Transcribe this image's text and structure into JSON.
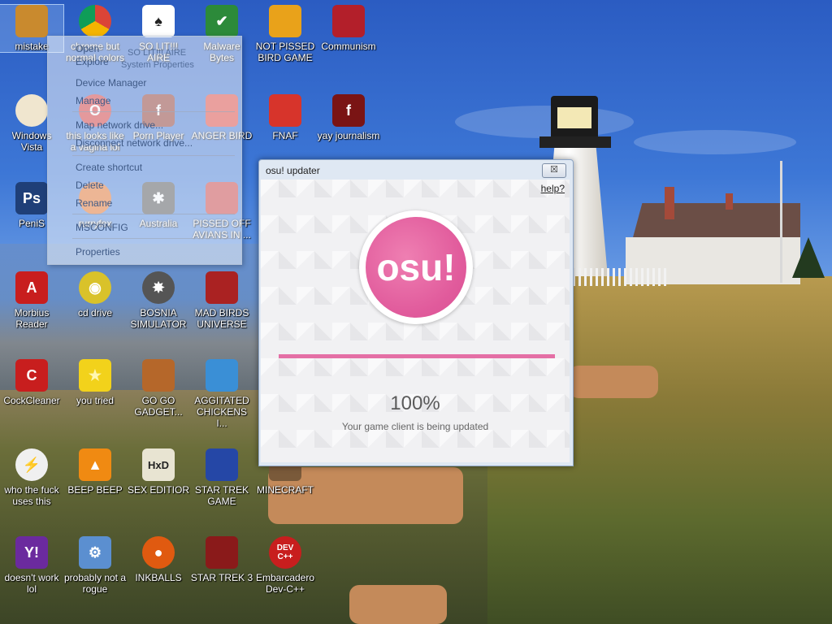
{
  "context_menu": {
    "items": [
      "Open",
      "Explore",
      "Manage",
      "Device Manager",
      "Map network drive...",
      "Disconnect network drive...",
      "Create shortcut",
      "Delete",
      "Rename",
      "MSCONFIG",
      "Properties"
    ],
    "overlay_labels": [
      "SO LIT!!! AIRE",
      "System Properties"
    ]
  },
  "icons": [
    {
      "label": "mistake",
      "icon": "folder-user-icon",
      "color": "#c98a2e",
      "glyph": ""
    },
    {
      "label": "chrome but normal colors",
      "icon": "chrome-icon",
      "color": "#3b8ee8",
      "glyph": ""
    },
    {
      "label": "SO LIT!!! AIRE",
      "icon": "solitaire-icon",
      "color": "#ffffff",
      "glyph": "♠"
    },
    {
      "label": "Malware Bytes",
      "icon": "shield-check-icon",
      "color": "#2c8a3a",
      "glyph": "✔"
    },
    {
      "label": "NOT PISSED BIRD GAME",
      "icon": "green-pig-icon",
      "color": "#e9a21a",
      "glyph": ""
    },
    {
      "label": "Communism",
      "icon": "winged-emblem-icon",
      "color": "#b31f2a",
      "glyph": ""
    },
    {
      "label": "Windows Vista",
      "icon": "egg-icon",
      "color": "#f0e6cf",
      "glyph": ""
    },
    {
      "label": "this looks like a vagina lol",
      "icon": "opera-icon",
      "color": "#d52b2b",
      "glyph": "O"
    },
    {
      "label": "Porn Player",
      "icon": "flash-player-icon",
      "color": "#8b2a20",
      "glyph": "f"
    },
    {
      "label": "ANGER BIRD",
      "icon": "red-bird-icon",
      "color": "#e23b2f",
      "glyph": ""
    },
    {
      "label": "FNAF",
      "icon": "red-bird-icon",
      "color": "#d7342b",
      "glyph": ""
    },
    {
      "label": "yay journalism",
      "icon": "flash-icon",
      "color": "#7a1414",
      "glyph": "f"
    },
    {
      "label": "PeniS",
      "icon": "photoshop-icon",
      "color": "#1f3f78",
      "glyph": "Ps"
    },
    {
      "label": "rurryfox",
      "icon": "firefox-icon",
      "color": "#e86a1c",
      "glyph": ""
    },
    {
      "label": "Australia",
      "icon": "spider-icon",
      "color": "#4a4a4a",
      "glyph": "✱"
    },
    {
      "label": "PISSED OFF AVIANS IN ...",
      "icon": "space-bird-icon",
      "color": "#c33",
      "glyph": ""
    },
    {
      "label": "Morbius Reader",
      "icon": "pdf-reader-icon",
      "color": "#c81e1e",
      "glyph": "A"
    },
    {
      "label": "cd drive",
      "icon": "cd-icon",
      "color": "#d9c22a",
      "glyph": "◉"
    },
    {
      "label": "BOSNIA SIMULATOR",
      "icon": "mine-icon",
      "color": "#555555",
      "glyph": "✸"
    },
    {
      "label": "MAD BIRDS UNIVERSE",
      "icon": "space-bird-icon",
      "color": "#a22",
      "glyph": ""
    },
    {
      "label": "CockCleaner",
      "icon": "ccleaner-icon",
      "color": "#c81e1e",
      "glyph": "C"
    },
    {
      "label": "you tried",
      "icon": "star-icon",
      "color": "#f2d21b",
      "glyph": "★"
    },
    {
      "label": "GO GO GADGET...",
      "icon": "toolbox-icon",
      "color": "#b5672a",
      "glyph": ""
    },
    {
      "label": "AGGITATED CHICKENS I...",
      "icon": "red-bird-icon",
      "color": "#3a8fd6",
      "glyph": ""
    },
    {
      "label": "who the fuck uses this",
      "icon": "lightning-icon",
      "color": "#f0f0f0",
      "glyph": "⚡"
    },
    {
      "label": "BEEP BEEP",
      "icon": "vlc-cone-icon",
      "color": "#f08a12",
      "glyph": "▲"
    },
    {
      "label": "SEX EDITIOR",
      "icon": "hxd-icon",
      "color": "#e8e4d2",
      "glyph": "HxD"
    },
    {
      "label": "STAR TREK GAME",
      "icon": "star-wars-icon",
      "color": "#2547a6",
      "glyph": ""
    },
    {
      "label": "MINECRAFT",
      "icon": "minecraft-icon",
      "color": "#7a5a3a",
      "glyph": ""
    },
    {
      "label": "doesn't work lol",
      "icon": "yahoo-messenger-icon",
      "color": "#6b2a9e",
      "glyph": "Y!"
    },
    {
      "label": "probably not a rogue",
      "icon": "gears-icon",
      "color": "#5b8fd0",
      "glyph": "⚙"
    },
    {
      "label": "INKBALLS",
      "icon": "inkball-icon",
      "color": "#e05a10",
      "glyph": "●"
    },
    {
      "label": "STAR TREK 3",
      "icon": "star-wars-icon",
      "color": "#8a1a1a",
      "glyph": ""
    },
    {
      "label": "Embarcadero Dev-C++",
      "icon": "devcpp-icon",
      "color": "#c81e1e",
      "glyph": "DEV C++"
    }
  ],
  "window": {
    "title": "osu! updater",
    "close": "☒",
    "help": "help?",
    "logo_text": "osu!",
    "progress": 1.0,
    "percent_text": "100%",
    "status_text": "Your game client is being updated",
    "accent": "#e46fa5"
  }
}
